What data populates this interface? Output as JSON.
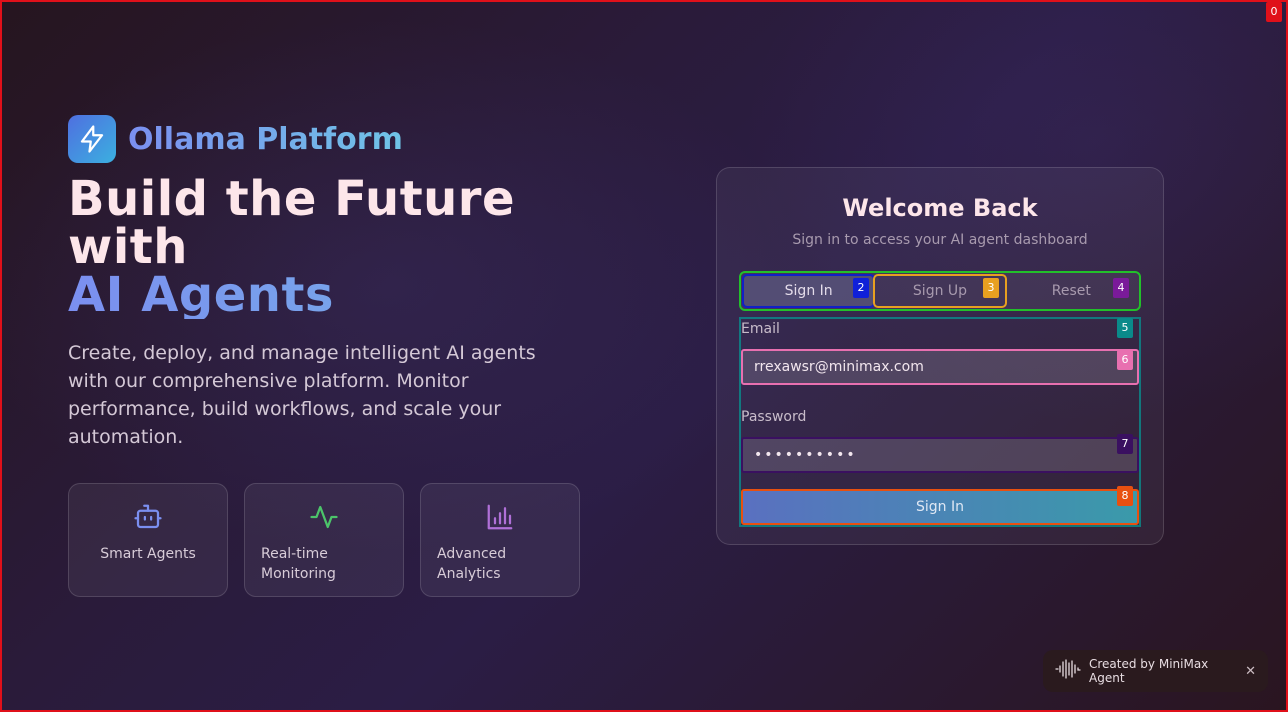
{
  "brand": {
    "name": "Ollama Platform"
  },
  "hero": {
    "headline_line1": "Build the Future",
    "headline_line2": "with",
    "headline_accent": "AI Agents",
    "description": "Create, deploy, and manage intelligent AI agents with our comprehensive platform. Monitor performance, build workflows, and scale your automation."
  },
  "features": [
    {
      "label": "Smart Agents",
      "icon": "robot-icon",
      "color": "#7b8ff0"
    },
    {
      "label": "Real-time Monitoring",
      "icon": "activity-icon",
      "color": "#4cc46a"
    },
    {
      "label": "Advanced Analytics",
      "icon": "bar-chart-icon",
      "color": "#b070d8"
    }
  ],
  "auth_card": {
    "title": "Welcome Back",
    "subtitle": "Sign in to access your AI agent dashboard",
    "tabs": [
      "Sign In",
      "Sign Up",
      "Reset"
    ],
    "active_tab": "Sign In",
    "email_label": "Email",
    "email_value": "rrexawsr@minimax.com",
    "password_label": "Password",
    "password_value": "••••••••••",
    "submit_label": "Sign In"
  },
  "overlay_badges": [
    "0",
    "2",
    "3",
    "4",
    "5",
    "6",
    "7",
    "8"
  ],
  "toast": {
    "text": "Created by MiniMax Agent",
    "close": "✕"
  },
  "colors": {
    "accent": "#7b8ff0",
    "accent2": "#3bb0e0",
    "frame": "#e0101a"
  }
}
